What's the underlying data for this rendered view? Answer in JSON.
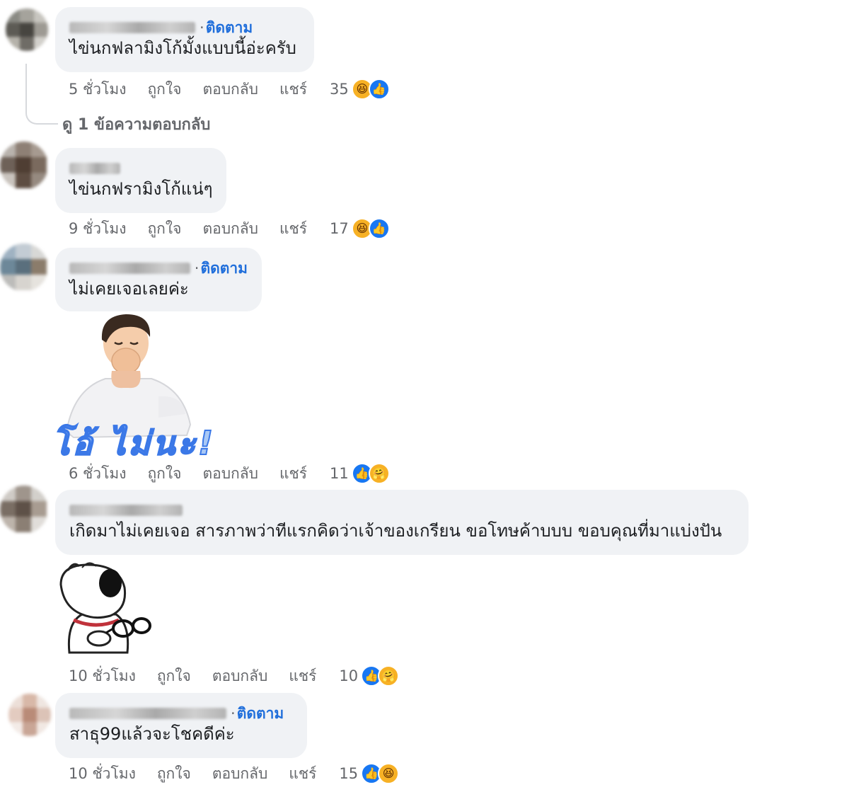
{
  "comments": [
    {
      "text": "ไข่นกฟลามิงโก้มั้งแบบนี้อ่ะครับ",
      "follow": "ติดตาม",
      "time": "5 ชั่วโมง",
      "like": "ถูกใจ",
      "reply": "ตอบกลับ",
      "share": "แชร์",
      "count": "35",
      "reactions": [
        "haha-icon",
        "like-icon"
      ],
      "view_replies": "ดู 1 ข้อความตอบกลับ"
    },
    {
      "text": "ไข่นกฟรามิงโก้แน่ๆ",
      "time": "9 ชั่วโมง",
      "like": "ถูกใจ",
      "reply": "ตอบกลับ",
      "share": "แชร์",
      "count": "17",
      "reactions": [
        "haha-icon",
        "like-icon"
      ]
    },
    {
      "text": "ไม่เคยเจอเลยค่ะ",
      "follow": "ติดตาม",
      "sticker_caption": "โอ้ ไม่นะ!",
      "time": "6 ชั่วโมง",
      "like": "ถูกใจ",
      "reply": "ตอบกลับ",
      "share": "แชร์",
      "count": "11",
      "reactions": [
        "like-icon",
        "care-icon"
      ]
    },
    {
      "text": "เกิดมาไม่เคยเจอ สารภาพว่าทีแรกคิดว่าเจ้าของเกรียน ขอโทษค้าบบบ ขอบคุณที่มาแบ่งปัน",
      "time": "10 ชั่วโมง",
      "like": "ถูกใจ",
      "reply": "ตอบกลับ",
      "share": "แชร์",
      "count": "10",
      "reactions": [
        "like-icon",
        "care-icon"
      ]
    },
    {
      "text": "สาธุ99แล้วจะโชคดีค่ะ",
      "follow": "ติดตาม",
      "time": "10 ชั่วโมง",
      "like": "ถูกใจ",
      "reply": "ตอบกลับ",
      "share": "แชร์",
      "count": "15",
      "reactions": [
        "like-icon",
        "haha-icon"
      ]
    }
  ],
  "colors": {
    "bubble": "#f0f2f5",
    "follow": "#216fdb",
    "meta": "#65676b",
    "like": "#1877f2",
    "haha": "#f7b125"
  }
}
